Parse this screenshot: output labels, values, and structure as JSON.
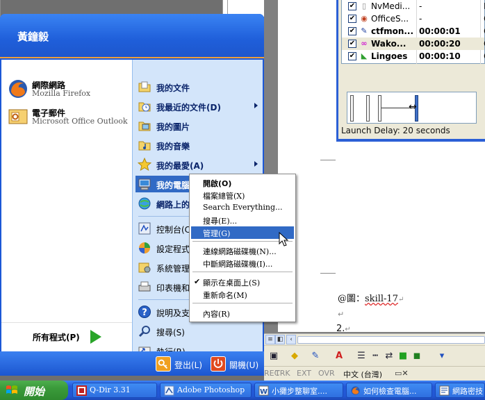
{
  "start_menu": {
    "user_name": "黃鐘毅",
    "pinned": [
      {
        "title": "網際網路",
        "subtitle": "Mozilla Firefox",
        "icon": "firefox-icon"
      },
      {
        "title": "電子郵件",
        "subtitle": "Microsoft Office Outlook",
        "icon": "outlook-icon"
      }
    ],
    "all_programs": "所有程式(P)",
    "right_items": [
      {
        "label": "我的文件",
        "icon": "my-documents-icon"
      },
      {
        "label": "我最近的文件(D)",
        "icon": "recent-documents-icon",
        "submenu": true
      },
      {
        "label": "我的圖片",
        "icon": "my-pictures-icon"
      },
      {
        "label": "我的音樂",
        "icon": "my-music-icon"
      },
      {
        "label": "我的最愛(A)",
        "icon": "favorites-star-icon",
        "submenu": true
      },
      {
        "label": "我的電腦",
        "icon": "my-computer-icon",
        "highlighted": true
      },
      {
        "label": "網路上的",
        "icon": "network-places-icon"
      },
      {
        "label": "控制台(C",
        "icon": "control-panel-icon"
      },
      {
        "label": "設定程式",
        "icon": "set-program-access-icon"
      },
      {
        "label": "系統管理",
        "icon": "admin-tools-icon"
      },
      {
        "label": "印表機和",
        "icon": "printers-icon"
      },
      {
        "label": "說明及支",
        "icon": "help-icon"
      },
      {
        "label": "搜尋(S)",
        "icon": "search-icon"
      },
      {
        "label": "執行(R)...",
        "icon": "run-icon"
      }
    ],
    "logoff": "登出(L)",
    "shutdown": "關機(U)"
  },
  "context_menu": {
    "items": [
      {
        "label": "開啟(O)",
        "bold": true
      },
      {
        "label": "檔案總管(X)"
      },
      {
        "label": "Search Everything..."
      },
      {
        "label": "搜尋(E)..."
      },
      {
        "label": "管理(G)",
        "highlighted": true
      },
      {
        "label": "連線網路磁碟機(N)..."
      },
      {
        "label": "中斷網路磁碟機(I)..."
      },
      {
        "label": "顯示在桌面上(S)",
        "checked": true
      },
      {
        "label": "重新命名(M)"
      },
      {
        "label": "內容(R)"
      }
    ]
  },
  "qdir": {
    "rows": [
      {
        "name": "NvMedi...",
        "time": "-",
        "extra": "R",
        "bold": false,
        "icon": "nvidia-icon"
      },
      {
        "name": "OfficeS...",
        "time": "-",
        "extra": "C",
        "bold": false,
        "icon": "office-icon"
      },
      {
        "name": "ctfmon...",
        "time": "00:00:01",
        "extra": "C",
        "bold": true,
        "icon": "ctfmon-icon"
      },
      {
        "name": "Wako...",
        "time": "00:00:20",
        "extra": "C",
        "bold": true,
        "icon": "wako-icon"
      },
      {
        "name": "Lingoes",
        "time": "00:00:10",
        "extra": "C",
        "bold": true,
        "icon": "lingoes-icon"
      }
    ],
    "launch_delay": "Launch Delay: 20 seconds"
  },
  "document": {
    "caption_prefix": "@圖：",
    "caption_word": "skill-17",
    "para_num": "2.",
    "return_mark": "↵"
  },
  "doc_status": {
    "cells": [
      "REC",
      "TRK",
      "EXT",
      "OVR"
    ],
    "language": "中文 (台灣)"
  },
  "taskbar": {
    "start_label": "開始",
    "buttons": [
      {
        "label": "Q-Dir 3.31",
        "icon": "qdir-icon"
      },
      {
        "label": "Adobe Photoshop",
        "icon": "photoshop-icon"
      },
      {
        "label": "小攤步整聊室....",
        "icon": "word-doc-icon"
      },
      {
        "label": "如何檢查電腦...",
        "icon": "firefox-icon"
      },
      {
        "label": "網路密技",
        "icon": "web-tips-icon"
      }
    ]
  },
  "colors": {
    "start_blue": "#1c58d6",
    "highlight": "#316ac5",
    "start_green": "#3a9a3a"
  }
}
